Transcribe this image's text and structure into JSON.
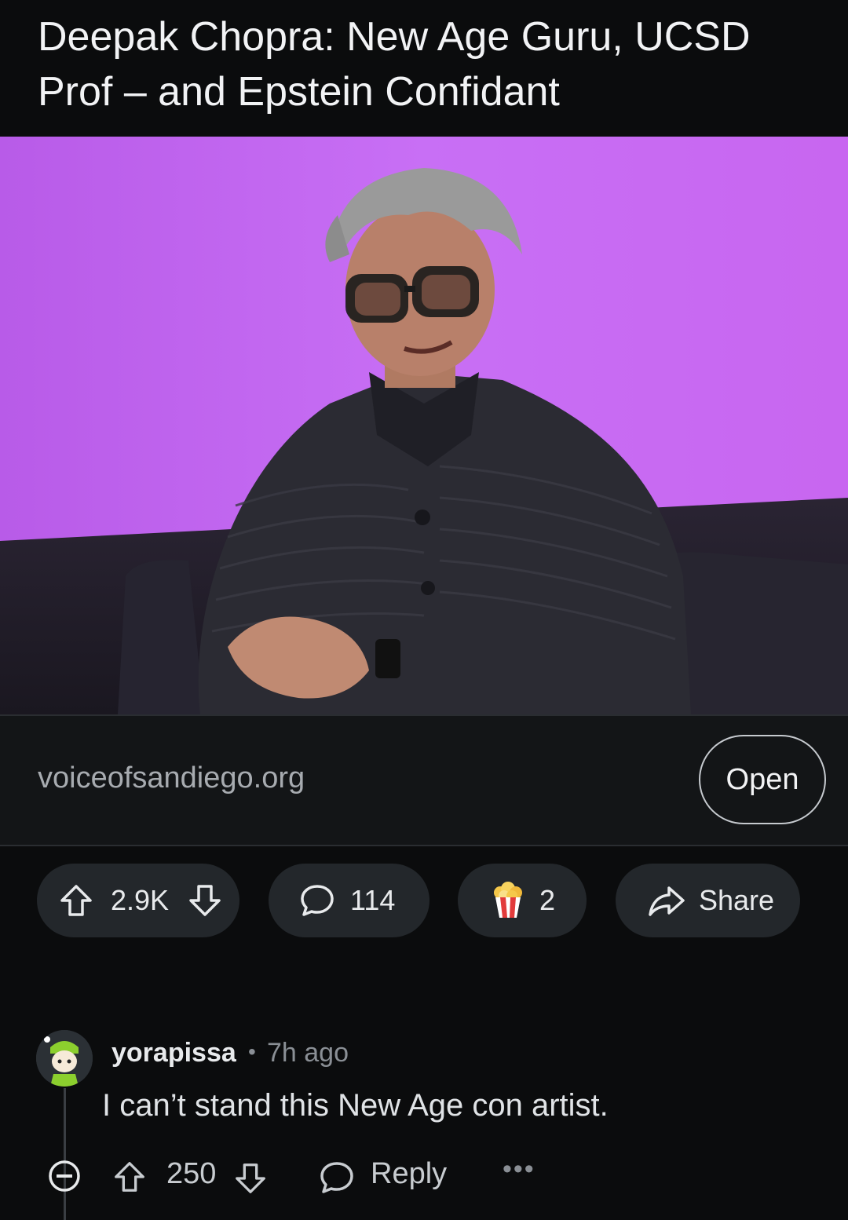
{
  "post": {
    "title": "Deepak Chopra: New Age Guru, UCSD Prof – and Epstein Confidant",
    "link_domain": "voiceofsandiego.org",
    "open_label": "Open"
  },
  "actions": {
    "score": "2.9K",
    "comments": "114",
    "awards": "2",
    "share_label": "Share"
  },
  "comment": {
    "username": "yorapissa",
    "separator": "•",
    "timestamp": "7h ago",
    "text": "I can’t stand this New Age con artist.",
    "score": "250",
    "reply_label": "Reply",
    "more_label": "•••"
  },
  "icons": {
    "upvote": "upvote-arrow-icon",
    "downvote": "downvote-arrow-icon",
    "comment": "speech-bubble-icon",
    "award": "popcorn-award-icon",
    "share": "share-arrow-icon",
    "collapse": "collapse-minus-icon"
  },
  "colors": {
    "background": "#0b0c0d",
    "pill": "#23272b",
    "hero_backdrop": "#c265f0"
  }
}
